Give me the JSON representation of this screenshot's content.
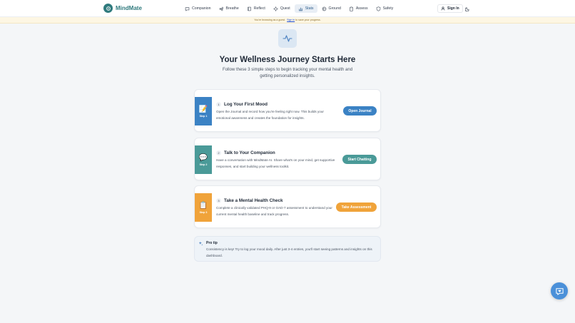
{
  "app": {
    "name": "MindMate"
  },
  "nav": {
    "items": [
      {
        "label": "Companion",
        "icon": "chat-bubble-icon"
      },
      {
        "label": "Breathe",
        "icon": "wind-icon"
      },
      {
        "label": "Reflect",
        "icon": "book-icon"
      },
      {
        "label": "Quest",
        "icon": "compass-icon"
      },
      {
        "label": "Stats",
        "icon": "bar-chart-icon",
        "active": true
      },
      {
        "label": "Ground",
        "icon": "globe-icon"
      },
      {
        "label": "Assess",
        "icon": "clipboard-icon"
      },
      {
        "label": "Safety",
        "icon": "shield-icon"
      }
    ],
    "signin_label": "Sign In"
  },
  "banner": {
    "prefix": "You're browsing as a guest.",
    "link": "Sign in",
    "suffix": "to save your progress."
  },
  "hero": {
    "title": "Your Wellness Journey Starts Here",
    "subtitle": "Follow these 3 simple steps to begin tracking your mental health and getting personalized insights."
  },
  "steps": [
    {
      "number": "1",
      "emoji": "📝",
      "step_label": "Step 1",
      "title": "Log Your First Mood",
      "description": "Open the Journal and record how you're feeling right now. This builds your emotional awareness and creates the foundation for insights.",
      "button": "Open Journal",
      "color": "#3b82c4",
      "button_color": "#3b82c4"
    },
    {
      "number": "2",
      "emoji": "💬",
      "step_label": "Step 2",
      "title": "Talk to Your Companion",
      "description": "Have a conversation with MindMate AI. Share what's on your mind, get supportive responses, and start building your wellness toolkit.",
      "button": "Start Chatting",
      "color": "#4a9a98",
      "button_color": "#4a9a98"
    },
    {
      "number": "3",
      "emoji": "📋",
      "step_label": "Step 3",
      "title": "Take a Mental Health Check",
      "description": "Complete a clinically validated PHQ-9 or GAD-7 assessment to understand your current mental health baseline and track progress.",
      "button": "Take Assessment",
      "color": "#f0a33a",
      "button_color": "#f0a33a"
    }
  ],
  "tip": {
    "title": "Pro tip",
    "text": "Consistency is key! Try to log your mood daily. After just 3-4 entries, you'll start seeing patterns and insights on this dashboard."
  },
  "colors": {
    "brand": "#2f7a7d",
    "fab": "#4a90d9"
  }
}
